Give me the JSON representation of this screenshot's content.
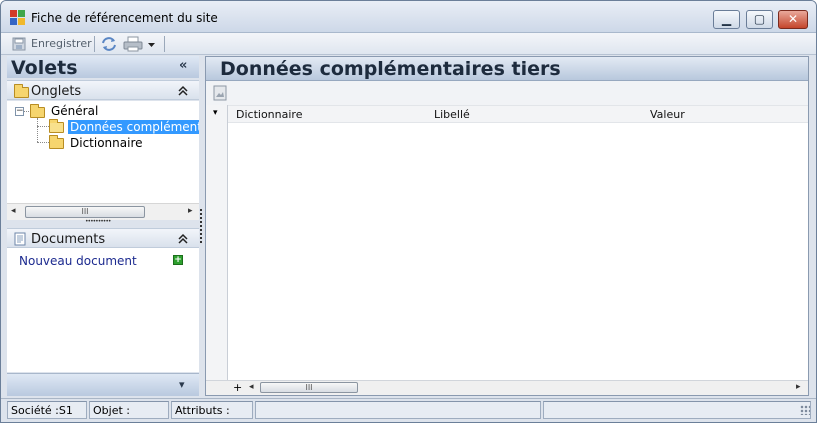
{
  "window": {
    "title": "Fiche de référencement du site",
    "controls": {
      "minimize": "▁",
      "maximize": "▢",
      "close": "✕"
    }
  },
  "toolbar": {
    "save_label": "Enregistrer",
    "icons": [
      "save-icon",
      "refresh-icon",
      "print-icon",
      "dropdown-arrow-icon"
    ]
  },
  "left_panel": {
    "title": "Volets",
    "collapse_glyph": "«",
    "onglets": {
      "label": "Onglets",
      "tree": [
        {
          "label": "Général",
          "expanded": true,
          "expander": "−"
        },
        {
          "label": "Données complémentaires tiers",
          "selected": true
        },
        {
          "label": "Dictionnaire"
        }
      ]
    },
    "scroll_thumb_label": "III",
    "splitter_dots": "••••••••••",
    "documents": {
      "label": "Documents",
      "new_document": "Nouveau document",
      "add_glyph": "+"
    },
    "footer_chevron": "▾"
  },
  "right_panel": {
    "title": "Données complémentaires tiers",
    "columns": [
      "Dictionnaire",
      "Libellé",
      "Valeur"
    ],
    "row_menu_glyph": "▾",
    "footer": {
      "add_glyph": "+",
      "thumb_label": "III"
    }
  },
  "status_bar": {
    "societe": "Société :S1",
    "objet": "Objet :",
    "attributs": "Attributs :"
  },
  "colors": {
    "selection": "#3399ff",
    "link": "#1c2a8f",
    "header": "#b8c8dd"
  }
}
